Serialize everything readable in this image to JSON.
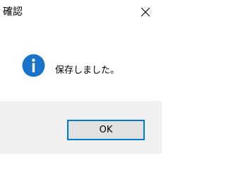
{
  "window": {
    "title": "確認",
    "close_icon": "close-icon"
  },
  "content": {
    "icon": "info-icon",
    "message": "保存しました。"
  },
  "footer": {
    "ok_label": "OK"
  },
  "colors": {
    "accent": "#0078d7",
    "footer_bg": "#f0f0f0",
    "button_bg": "#e1e1e1",
    "info_icon": "#1a73c8"
  }
}
